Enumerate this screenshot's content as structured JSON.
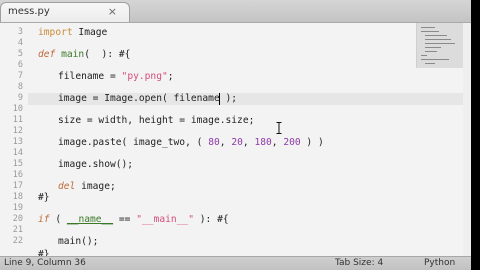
{
  "tab": {
    "title": "mess.py",
    "close_glyph": "×"
  },
  "line_numbers": [
    "3",
    "4",
    "5",
    "6",
    "7",
    "8",
    "9",
    "10",
    "11",
    "12",
    "13",
    "14",
    "15",
    "16",
    "17",
    "18",
    "19",
    "20",
    "21",
    "22"
  ],
  "code": {
    "l3_kw": "import",
    "l3_rest": " Image",
    "l5_kw": "def",
    "l5_fn": "main",
    "l5_rest": "(  ): #{",
    "l7_a": "filename = ",
    "l7_str": "\"py.png\"",
    "l7_b": ";",
    "l9_a": "image = Image.open( filename );",
    "l11_a": "size = width, height = image.size;",
    "l13_a": "image.paste( image_two, ( ",
    "l13_n1": "80",
    "l13_c1": ", ",
    "l13_n2": "20",
    "l13_c2": ", ",
    "l13_n3": "180",
    "l13_c3": ", ",
    "l13_n4": "200",
    "l13_b": " ) )",
    "l15_a": "image.show();",
    "l17_kw": "del",
    "l17_rest": " image;",
    "l18_a": "#}",
    "l20_kw": "if",
    "l20_a": " ( ",
    "l20_var": "__name__",
    "l20_b": " == ",
    "l20_str": "\"__main__\"",
    "l20_c": " ): #{",
    "l22_a": "main();",
    "l23_a": "#}"
  },
  "status": {
    "position": "Line 9, Column 36",
    "tab_size": "Tab Size: 4",
    "syntax": "Python"
  },
  "icons": {
    "cursor": "i-beam-cursor-icon"
  }
}
